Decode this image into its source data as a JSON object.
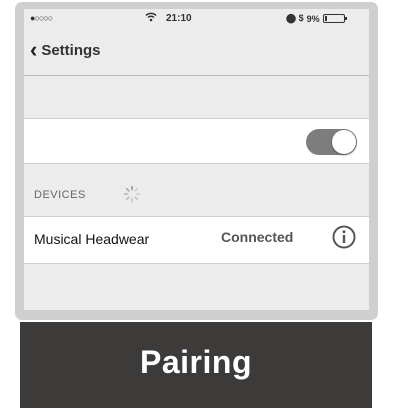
{
  "status_bar": {
    "signal": "●○○○○",
    "wifi_icon": "wifi-icon",
    "time": "21:10",
    "indicators": "⬤ $",
    "battery_percent": "9%",
    "battery_level": 0.09
  },
  "nav": {
    "back_label": "Settings"
  },
  "bluetooth_toggle": {
    "state": "on"
  },
  "devices": {
    "header": "DEVICES",
    "items": [
      {
        "name": "Musical Headwear",
        "status": "Connected"
      }
    ]
  },
  "banner": {
    "title": "Pairing"
  },
  "colors": {
    "banner_bg": "#3d3b3a",
    "toggle_on": "#7d7d7d",
    "screen_bg": "#ececec"
  }
}
